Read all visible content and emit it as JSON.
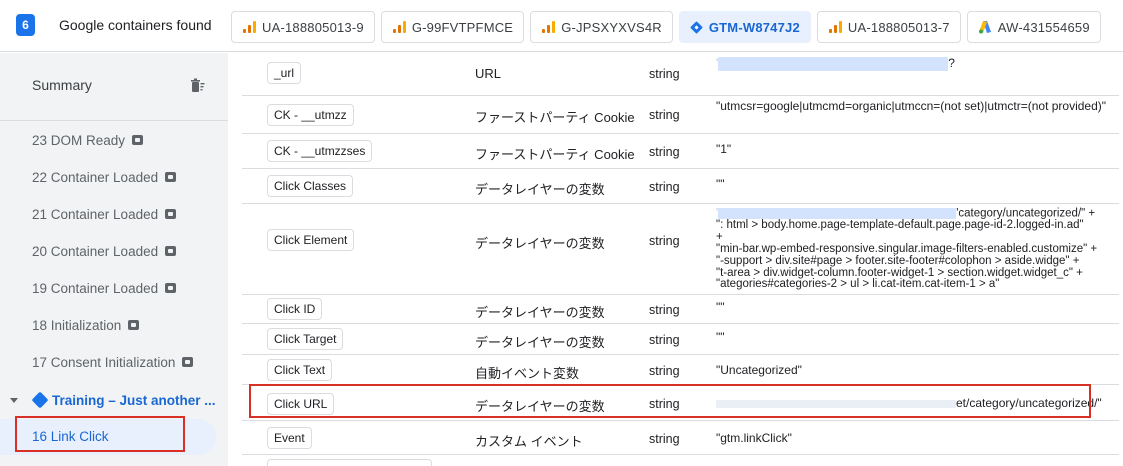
{
  "topbar": {
    "count": "6",
    "found_label": "Google containers found",
    "tabs": [
      {
        "label": "UA-188805013-9",
        "icon": "analytics-bars-icon",
        "active": false
      },
      {
        "label": "G-99FVTPFMCE",
        "icon": "analytics-bars-icon",
        "active": false
      },
      {
        "label": "G-JPSXYXVS4R",
        "icon": "analytics-bars-icon",
        "active": false
      },
      {
        "label": "GTM-W8747J2",
        "icon": "gtm-diamond-icon",
        "active": true
      },
      {
        "label": "UA-188805013-7",
        "icon": "analytics-bars-icon",
        "active": false
      },
      {
        "label": "AW-431554659",
        "icon": "google-ads-icon",
        "active": false
      }
    ]
  },
  "sidebar": {
    "summary_label": "Summary",
    "events": [
      {
        "label": "23 DOM Ready"
      },
      {
        "label": "22 Container Loaded"
      },
      {
        "label": "21 Container Loaded"
      },
      {
        "label": "20 Container Loaded"
      },
      {
        "label": "19 Container Loaded"
      },
      {
        "label": "18 Initialization"
      },
      {
        "label": "17 Consent Initialization"
      }
    ],
    "group_label": "Training – Just another ...",
    "selected_event": "16 Link Click"
  },
  "variables": {
    "rows": [
      {
        "name": "_url",
        "type": "URL",
        "kind": "string",
        "value": "?"
      },
      {
        "name": "CK - __utmzz",
        "type": "ファーストパーティ Cookie",
        "kind": "string",
        "value": "\"utmcsr=google|utmcmd=organic|utmccn=(not set)|utmctr=(not provided)\""
      },
      {
        "name": "CK - __utmzzses",
        "type": "ファーストパーティ Cookie",
        "kind": "string",
        "value": "\"1\""
      },
      {
        "name": "Click Classes",
        "type": "データレイヤーの変数",
        "kind": "string",
        "value": "\"\""
      },
      {
        "name": "Click Element",
        "type": "データレイヤーの変数",
        "kind": "string",
        "value_lines": [
          "'category/uncategorized/\" +",
          "\": html > body.home.page-template-default.page.page-id-2.logged-in.ad\"",
          "+",
          "\"min-bar.wp-embed-responsive.singular.image-filters-enabled.customize\" +",
          "\"-support > div.site#page > footer.site-footer#colophon > aside.widge\" +",
          "\"t-area > div.widget-column.footer-widget-1 > section.widget.widget_c\" +",
          "\"ategories#categories-2 > ul > li.cat-item.cat-item-1 > a\""
        ]
      },
      {
        "name": "Click ID",
        "type": "データレイヤーの変数",
        "kind": "string",
        "value": "\"\""
      },
      {
        "name": "Click Target",
        "type": "データレイヤーの変数",
        "kind": "string",
        "value": "\"\""
      },
      {
        "name": "Click Text",
        "type": "自動イベント変数",
        "kind": "string",
        "value": "\"Uncategorized\""
      },
      {
        "name": "Click URL",
        "type": "データレイヤーの変数",
        "kind": "string",
        "value": "et/category/uncategorized/\""
      },
      {
        "name": "Event",
        "type": "カスタム イベント",
        "kind": "string",
        "value": "\"gtm.linkClick\""
      }
    ]
  }
}
